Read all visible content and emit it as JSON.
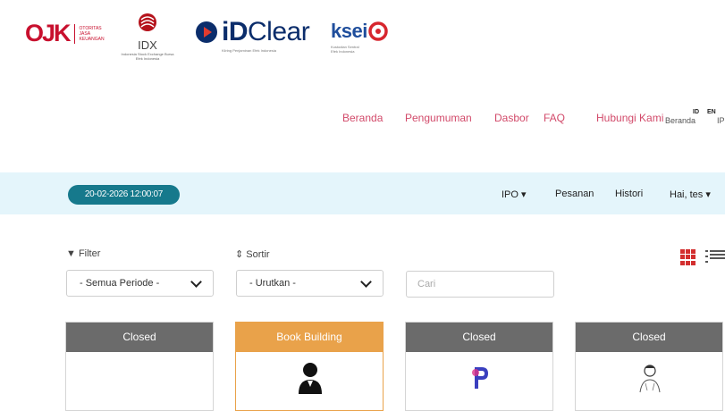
{
  "partners": {
    "ojk": {
      "mark": "OJK",
      "lines": [
        "OTORITAS",
        "JASA",
        "KEUANGAN"
      ]
    },
    "idx": {
      "name": "IDX",
      "sub": "Indonesia Stock Exchange Bursa Efek Indonesia"
    },
    "idclear": {
      "bold": "iD",
      "rest": "Clear",
      "tagline": "Kliring Penjaminan Efek Indonesia"
    },
    "ksei": {
      "name": "ksei",
      "sub": "Kustodian Sentral Efek Indonesia"
    }
  },
  "top_nav": {
    "items": [
      "Beranda",
      "Pengumuman",
      "Dasbor",
      "FAQ",
      "Hubungi Kami"
    ],
    "overlap_label": "Beranda",
    "lang_id": "ID",
    "lang_en": "EN",
    "edge_label": "IP"
  },
  "bar": {
    "datetime": "20-02-2026 12:00:07",
    "menu": {
      "ipo": "IPO ▾",
      "pesanan": "Pesanan",
      "histori": "Histori",
      "user": "Hai, tes ▾"
    }
  },
  "filters": {
    "filter_label": "▼ Filter",
    "sort_label": "⇕ Sortir",
    "period_value": "- Semua Periode -",
    "sort_value": "- Urutkan -",
    "search_placeholder": "Cari"
  },
  "view_toggle": {
    "grid_icon": "grid-view-icon",
    "list_icon": "list-view-icon"
  },
  "cards": [
    {
      "status": "Closed",
      "logo": "none"
    },
    {
      "status": "Book Building",
      "logo": "person-silhouette"
    },
    {
      "status": "Closed",
      "logo": "p-logo"
    },
    {
      "status": "Closed",
      "logo": "sketch-portrait"
    }
  ],
  "colors": {
    "brand_red": "#c8102e",
    "nav_pink": "#d24a6a",
    "bar_bg": "#e4f5fb",
    "clock_bg": "#16798c",
    "closed_header": "#6b6b6b",
    "bookbuilding_header": "#e9a24a"
  }
}
